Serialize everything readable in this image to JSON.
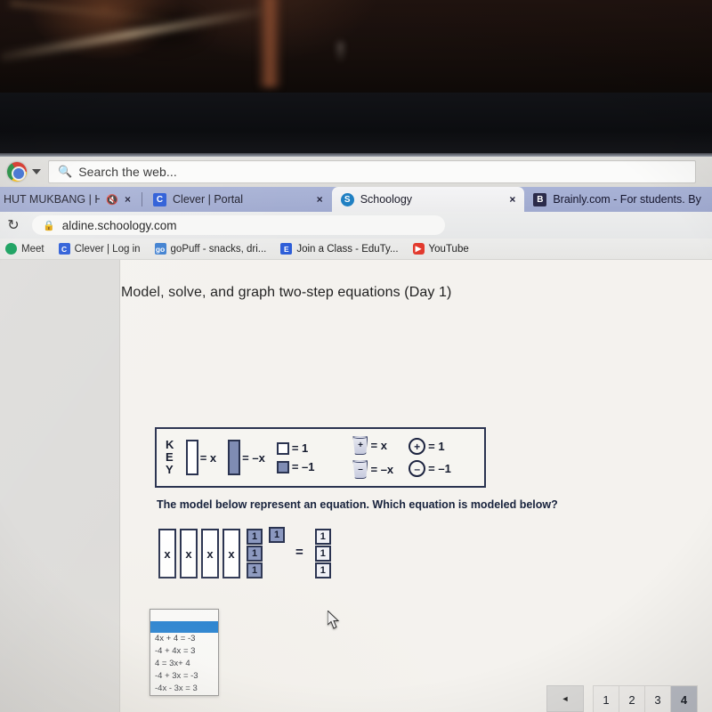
{
  "browser": {
    "search_strip": {
      "logo_icon": "chrome-logo-icon",
      "caret_icon": "chevron-down-icon",
      "search_icon": "search-icon",
      "placeholder": "Search the web..."
    },
    "tabs": [
      {
        "title": "HUT MUKBANG | HOW",
        "favicon": "",
        "mute_icon": "speaker-mute-icon",
        "close_icon": "×",
        "active": false
      },
      {
        "title": "Clever | Portal",
        "favicon": "C",
        "close_icon": "×",
        "active": false
      },
      {
        "title": "Schoology",
        "favicon": "S",
        "close_icon": "×",
        "active": true
      },
      {
        "title": "Brainly.com - For students. By st..",
        "favicon": "B",
        "close_icon": "×",
        "active": false
      }
    ],
    "address_bar": {
      "reload_icon": "↻",
      "lock_icon": "🔒",
      "url": "aldine.schoology.com"
    },
    "bookmarks": [
      {
        "label": "Meet",
        "favicon": "●"
      },
      {
        "label": "Clever | Log in",
        "favicon": "C"
      },
      {
        "label": "goPuff - snacks, dri...",
        "favicon": "go"
      },
      {
        "label": "Join a Class - EduTy...",
        "favicon": "E"
      },
      {
        "label": "YouTube",
        "favicon": "▶"
      }
    ]
  },
  "page": {
    "title": "Model, solve, and graph two-step equations (Day 1)",
    "key_box": {
      "heading": "KEY",
      "entries": [
        {
          "shape": "white-bar",
          "equals": "= x"
        },
        {
          "shape": "dark-bar",
          "equals": "= –x"
        },
        {
          "shape": "white-square",
          "equals": "= 1"
        },
        {
          "shape": "dark-square",
          "equals": "= –1"
        },
        {
          "shape": "cup-plus",
          "symbol": "+",
          "equals": "= x"
        },
        {
          "shape": "cup-minus",
          "symbol": "–",
          "equals": "= –x"
        },
        {
          "shape": "circle-plus",
          "symbol": "+",
          "equals": "= 1"
        },
        {
          "shape": "circle-minus",
          "symbol": "–",
          "equals": "= –1"
        }
      ]
    },
    "question_prompt": "The model below represent an equation. Which equation is modeled below?",
    "model": {
      "x_bar_label": "x",
      "x_bar_count": 4,
      "left_ones_column": [
        "1",
        "1",
        "1"
      ],
      "stray_one": "1",
      "equals": "=",
      "right_ones_column": [
        "1",
        "1",
        "1"
      ]
    },
    "answer_dropdown": {
      "selected_value": "",
      "options": [
        "4x + 4 = -3",
        "-4 + 4x = 3",
        "4 = 3x+ 4",
        "-4 + 3x = -3",
        "-4x - 3x = 3"
      ]
    },
    "pagination": {
      "prev_label": "◄",
      "pages": [
        "1",
        "2",
        "3",
        "4"
      ],
      "active_page": "4"
    }
  },
  "colors": {
    "tab_strip": "#a9b3d6",
    "dropdown_highlight": "#1679cf",
    "model_ink": "#2a3350",
    "tile_fill": "#8b98bf",
    "pagination_underline": "#2f7fd0"
  }
}
